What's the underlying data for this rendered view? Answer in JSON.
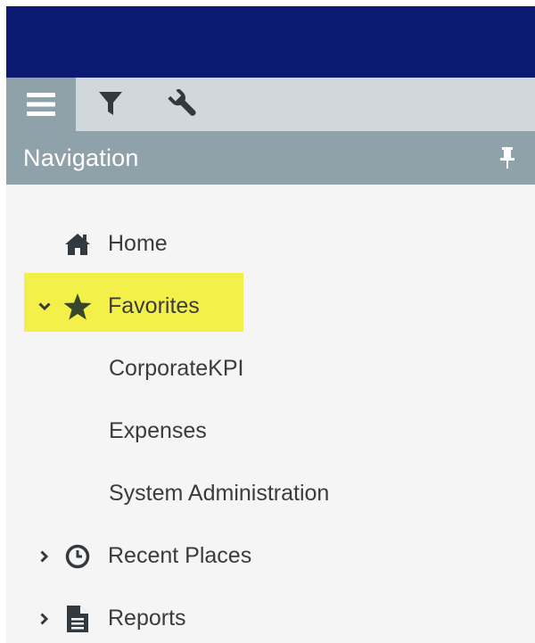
{
  "toolbar": {
    "tabs": [
      {
        "icon": "hamburger-menu-icon",
        "active": true
      },
      {
        "icon": "filter-icon",
        "active": false
      },
      {
        "icon": "wrench-icon",
        "active": false
      }
    ]
  },
  "header": {
    "title": "Navigation",
    "pin_icon": "pin-icon"
  },
  "nav": {
    "home": {
      "label": "Home",
      "icon": "home-icon"
    },
    "favorites": {
      "label": "Favorites",
      "icon": "star-icon",
      "expanded": true,
      "highlighted": true,
      "children": [
        "CorporateKPI",
        "Expenses",
        "System Administration"
      ]
    },
    "recent": {
      "label": "Recent Places",
      "icon": "clock-icon",
      "expanded": false
    },
    "reports": {
      "label": "Reports",
      "icon": "document-icon",
      "expanded": false
    }
  },
  "colors": {
    "topbar": "#0c1a72",
    "toolbar": "#d0d8dd",
    "header": "#8fa1a9",
    "panel": "#f5f5f5",
    "highlight": "#f3f04a",
    "text": "#3b3b3b"
  }
}
